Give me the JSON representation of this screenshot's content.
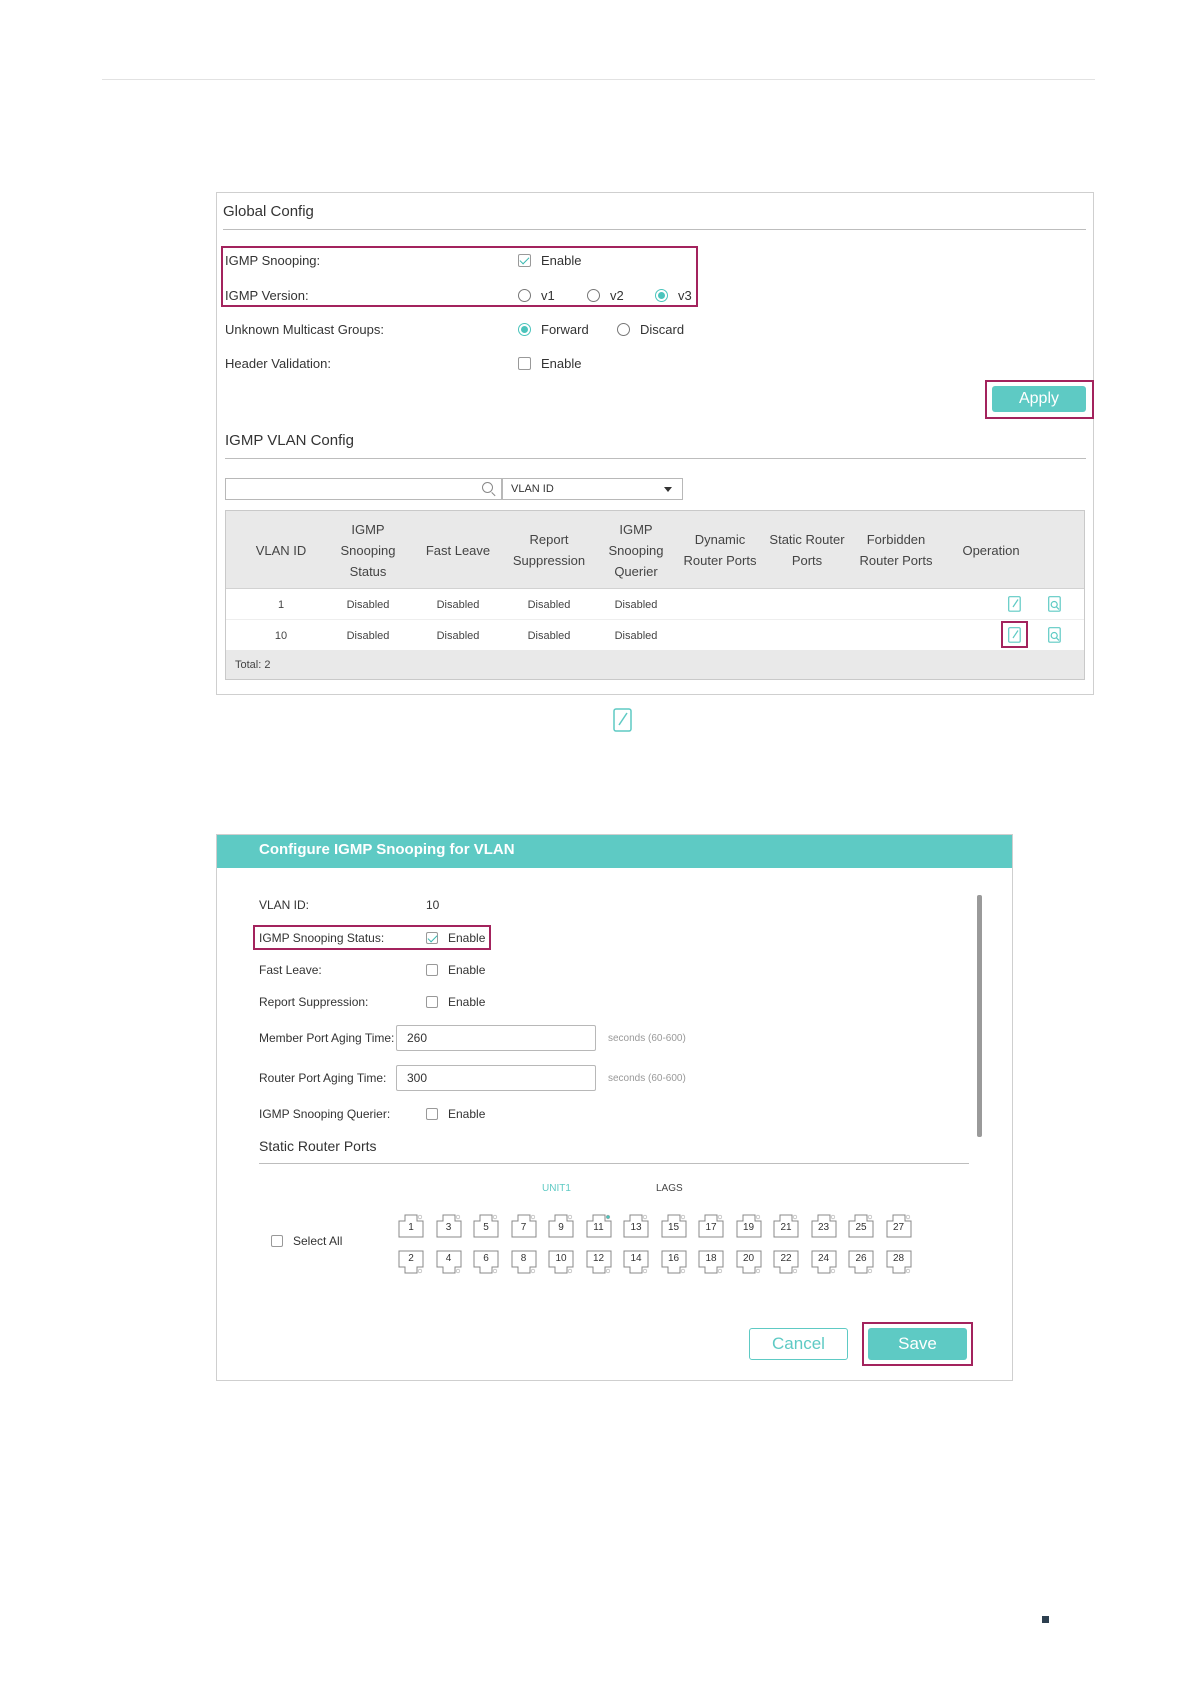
{
  "global_config": {
    "title": "Global Config",
    "igmp_snooping_label": "IGMP Snooping:",
    "igmp_snooping_enable": "Enable",
    "igmp_snooping_checked": true,
    "igmp_version_label": "IGMP Version:",
    "igmp_version_options": [
      "v1",
      "v2",
      "v3"
    ],
    "igmp_version_selected": "v3",
    "unknown_multicast_label": "Unknown Multicast Groups:",
    "unknown_multicast_options": [
      "Forward",
      "Discard"
    ],
    "unknown_multicast_selected": "Forward",
    "header_validation_label": "Header Validation:",
    "header_validation_enable": "Enable",
    "header_validation_checked": false,
    "apply_label": "Apply"
  },
  "vlan_config": {
    "title": "IGMP VLAN Config",
    "search_value": "",
    "search_field": "VLAN ID",
    "columns": [
      "VLAN ID",
      "IGMP\nSnooping\nStatus",
      "Fast Leave",
      "Report\nSuppression",
      "IGMP\nSnooping\nQuerier",
      "Dynamic\nRouter Ports",
      "Static Router\nPorts",
      "Forbidden\nRouter Ports",
      "Operation"
    ],
    "rows": [
      [
        "1",
        "Disabled",
        "Disabled",
        "Disabled",
        "Disabled",
        "",
        "",
        ""
      ],
      [
        "10",
        "Disabled",
        "Disabled",
        "Disabled",
        "Disabled",
        "",
        "",
        ""
      ]
    ],
    "total": "Total: 2",
    "operation_icons": [
      "edit-icon",
      "detail-icon"
    ]
  },
  "vlan_dialog": {
    "title": "Configure IGMP Snooping for VLAN",
    "vlan_id_label": "VLAN ID:",
    "vlan_id_value": "10",
    "snooping_status_label": "IGMP Snooping Status:",
    "snooping_status_enable": "Enable",
    "snooping_status_checked": true,
    "fast_leave_label": "Fast Leave:",
    "fast_leave_enable": "Enable",
    "report_suppression_label": "Report Suppression:",
    "report_suppression_enable": "Enable",
    "member_aging_label": "Member Port Aging Time:",
    "member_aging_value": "260",
    "member_aging_hint": "seconds (60-600)",
    "router_aging_label": "Router Port Aging Time:",
    "router_aging_value": "300",
    "router_aging_hint": "seconds (60-600)",
    "querier_label": "IGMP Snooping Querier:",
    "querier_enable": "Enable",
    "static_router_title": "Static Router Ports",
    "unit_tab": "UNIT1",
    "lags_tab": "LAGS",
    "select_all": "Select All",
    "ports_top": [
      "1",
      "3",
      "5",
      "7",
      "9",
      "11",
      "13",
      "15",
      "17",
      "19",
      "21",
      "23",
      "25",
      "27"
    ],
    "ports_bottom": [
      "2",
      "4",
      "6",
      "8",
      "10",
      "12",
      "14",
      "16",
      "18",
      "20",
      "22",
      "24",
      "26",
      "28"
    ],
    "cancel_label": "Cancel",
    "save_label": "Save"
  },
  "colors": {
    "accent": "#5ecac4",
    "highlight": "#a3235d"
  }
}
